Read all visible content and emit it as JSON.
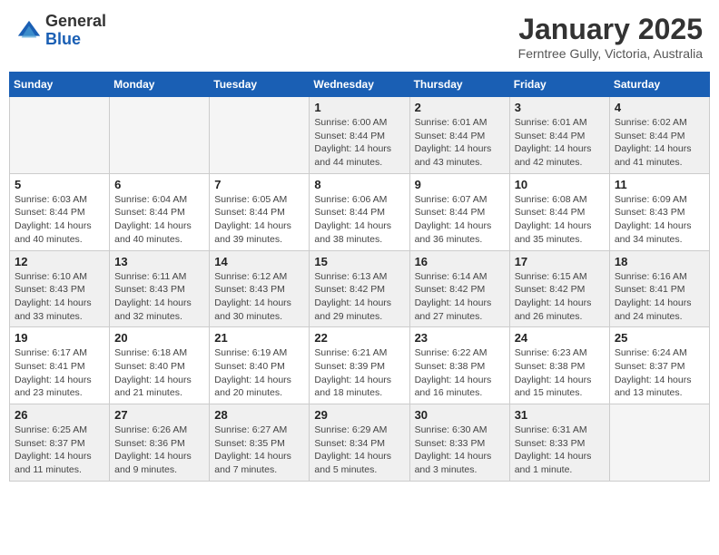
{
  "header": {
    "logo": {
      "general": "General",
      "blue": "Blue"
    },
    "title": "January 2025",
    "location": "Ferntree Gully, Victoria, Australia"
  },
  "calendar": {
    "weekdays": [
      "Sunday",
      "Monday",
      "Tuesday",
      "Wednesday",
      "Thursday",
      "Friday",
      "Saturday"
    ],
    "weeks": [
      [
        {
          "day": "",
          "sunrise": "",
          "sunset": "",
          "daylight": "",
          "empty": true
        },
        {
          "day": "",
          "sunrise": "",
          "sunset": "",
          "daylight": "",
          "empty": true
        },
        {
          "day": "",
          "sunrise": "",
          "sunset": "",
          "daylight": "",
          "empty": true
        },
        {
          "day": "1",
          "sunrise": "Sunrise: 6:00 AM",
          "sunset": "Sunset: 8:44 PM",
          "daylight": "Daylight: 14 hours and 44 minutes."
        },
        {
          "day": "2",
          "sunrise": "Sunrise: 6:01 AM",
          "sunset": "Sunset: 8:44 PM",
          "daylight": "Daylight: 14 hours and 43 minutes."
        },
        {
          "day": "3",
          "sunrise": "Sunrise: 6:01 AM",
          "sunset": "Sunset: 8:44 PM",
          "daylight": "Daylight: 14 hours and 42 minutes."
        },
        {
          "day": "4",
          "sunrise": "Sunrise: 6:02 AM",
          "sunset": "Sunset: 8:44 PM",
          "daylight": "Daylight: 14 hours and 41 minutes."
        }
      ],
      [
        {
          "day": "5",
          "sunrise": "Sunrise: 6:03 AM",
          "sunset": "Sunset: 8:44 PM",
          "daylight": "Daylight: 14 hours and 40 minutes."
        },
        {
          "day": "6",
          "sunrise": "Sunrise: 6:04 AM",
          "sunset": "Sunset: 8:44 PM",
          "daylight": "Daylight: 14 hours and 40 minutes."
        },
        {
          "day": "7",
          "sunrise": "Sunrise: 6:05 AM",
          "sunset": "Sunset: 8:44 PM",
          "daylight": "Daylight: 14 hours and 39 minutes."
        },
        {
          "day": "8",
          "sunrise": "Sunrise: 6:06 AM",
          "sunset": "Sunset: 8:44 PM",
          "daylight": "Daylight: 14 hours and 38 minutes."
        },
        {
          "day": "9",
          "sunrise": "Sunrise: 6:07 AM",
          "sunset": "Sunset: 8:44 PM",
          "daylight": "Daylight: 14 hours and 36 minutes."
        },
        {
          "day": "10",
          "sunrise": "Sunrise: 6:08 AM",
          "sunset": "Sunset: 8:44 PM",
          "daylight": "Daylight: 14 hours and 35 minutes."
        },
        {
          "day": "11",
          "sunrise": "Sunrise: 6:09 AM",
          "sunset": "Sunset: 8:43 PM",
          "daylight": "Daylight: 14 hours and 34 minutes."
        }
      ],
      [
        {
          "day": "12",
          "sunrise": "Sunrise: 6:10 AM",
          "sunset": "Sunset: 8:43 PM",
          "daylight": "Daylight: 14 hours and 33 minutes."
        },
        {
          "day": "13",
          "sunrise": "Sunrise: 6:11 AM",
          "sunset": "Sunset: 8:43 PM",
          "daylight": "Daylight: 14 hours and 32 minutes."
        },
        {
          "day": "14",
          "sunrise": "Sunrise: 6:12 AM",
          "sunset": "Sunset: 8:43 PM",
          "daylight": "Daylight: 14 hours and 30 minutes."
        },
        {
          "day": "15",
          "sunrise": "Sunrise: 6:13 AM",
          "sunset": "Sunset: 8:42 PM",
          "daylight": "Daylight: 14 hours and 29 minutes."
        },
        {
          "day": "16",
          "sunrise": "Sunrise: 6:14 AM",
          "sunset": "Sunset: 8:42 PM",
          "daylight": "Daylight: 14 hours and 27 minutes."
        },
        {
          "day": "17",
          "sunrise": "Sunrise: 6:15 AM",
          "sunset": "Sunset: 8:42 PM",
          "daylight": "Daylight: 14 hours and 26 minutes."
        },
        {
          "day": "18",
          "sunrise": "Sunrise: 6:16 AM",
          "sunset": "Sunset: 8:41 PM",
          "daylight": "Daylight: 14 hours and 24 minutes."
        }
      ],
      [
        {
          "day": "19",
          "sunrise": "Sunrise: 6:17 AM",
          "sunset": "Sunset: 8:41 PM",
          "daylight": "Daylight: 14 hours and 23 minutes."
        },
        {
          "day": "20",
          "sunrise": "Sunrise: 6:18 AM",
          "sunset": "Sunset: 8:40 PM",
          "daylight": "Daylight: 14 hours and 21 minutes."
        },
        {
          "day": "21",
          "sunrise": "Sunrise: 6:19 AM",
          "sunset": "Sunset: 8:40 PM",
          "daylight": "Daylight: 14 hours and 20 minutes."
        },
        {
          "day": "22",
          "sunrise": "Sunrise: 6:21 AM",
          "sunset": "Sunset: 8:39 PM",
          "daylight": "Daylight: 14 hours and 18 minutes."
        },
        {
          "day": "23",
          "sunrise": "Sunrise: 6:22 AM",
          "sunset": "Sunset: 8:38 PM",
          "daylight": "Daylight: 14 hours and 16 minutes."
        },
        {
          "day": "24",
          "sunrise": "Sunrise: 6:23 AM",
          "sunset": "Sunset: 8:38 PM",
          "daylight": "Daylight: 14 hours and 15 minutes."
        },
        {
          "day": "25",
          "sunrise": "Sunrise: 6:24 AM",
          "sunset": "Sunset: 8:37 PM",
          "daylight": "Daylight: 14 hours and 13 minutes."
        }
      ],
      [
        {
          "day": "26",
          "sunrise": "Sunrise: 6:25 AM",
          "sunset": "Sunset: 8:37 PM",
          "daylight": "Daylight: 14 hours and 11 minutes."
        },
        {
          "day": "27",
          "sunrise": "Sunrise: 6:26 AM",
          "sunset": "Sunset: 8:36 PM",
          "daylight": "Daylight: 14 hours and 9 minutes."
        },
        {
          "day": "28",
          "sunrise": "Sunrise: 6:27 AM",
          "sunset": "Sunset: 8:35 PM",
          "daylight": "Daylight: 14 hours and 7 minutes."
        },
        {
          "day": "29",
          "sunrise": "Sunrise: 6:29 AM",
          "sunset": "Sunset: 8:34 PM",
          "daylight": "Daylight: 14 hours and 5 minutes."
        },
        {
          "day": "30",
          "sunrise": "Sunrise: 6:30 AM",
          "sunset": "Sunset: 8:33 PM",
          "daylight": "Daylight: 14 hours and 3 minutes."
        },
        {
          "day": "31",
          "sunrise": "Sunrise: 6:31 AM",
          "sunset": "Sunset: 8:33 PM",
          "daylight": "Daylight: 14 hours and 1 minute."
        },
        {
          "day": "",
          "sunrise": "",
          "sunset": "",
          "daylight": "",
          "empty": true
        }
      ]
    ]
  }
}
